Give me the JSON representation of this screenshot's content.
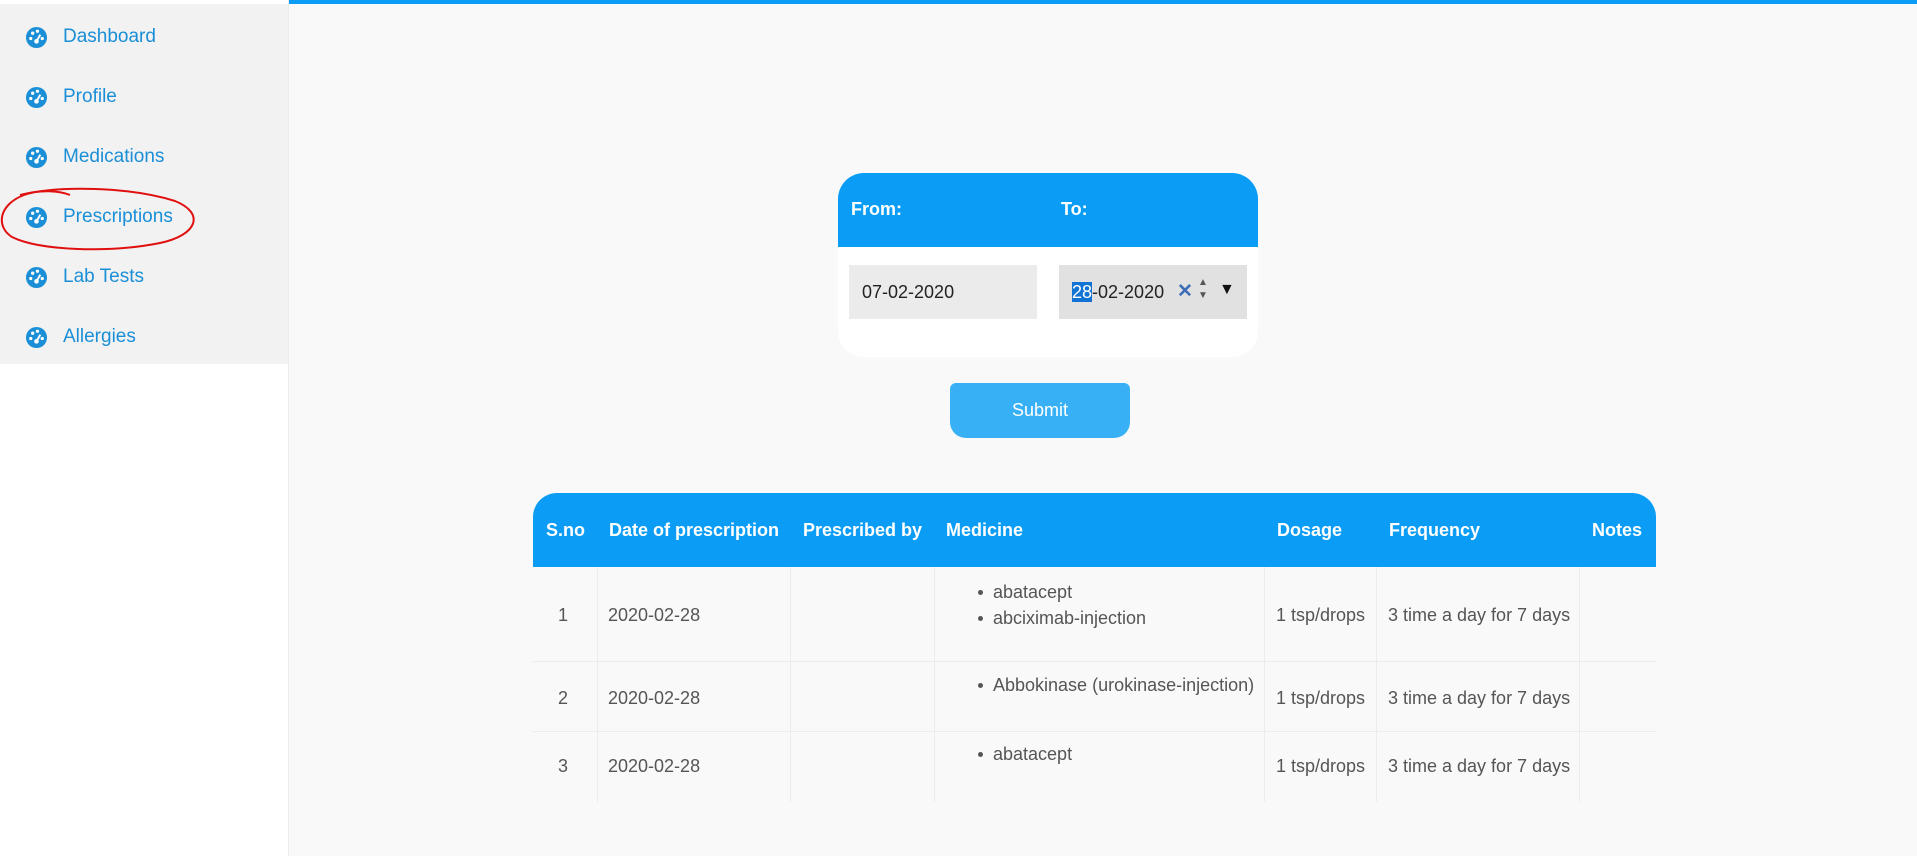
{
  "sidebar": {
    "items": [
      {
        "label": "Dashboard",
        "icon": "dashboard-gauge-icon"
      },
      {
        "label": "Profile",
        "icon": "dashboard-gauge-icon"
      },
      {
        "label": "Medications",
        "icon": "dashboard-gauge-icon"
      },
      {
        "label": "Prescriptions",
        "icon": "dashboard-gauge-icon",
        "highlighted": true
      },
      {
        "label": "Lab Tests",
        "icon": "dashboard-gauge-icon"
      },
      {
        "label": "Allergies",
        "icon": "dashboard-gauge-icon"
      }
    ]
  },
  "filter": {
    "from_label": "From:",
    "to_label": "To:",
    "from_value": "07-02-2020",
    "to_value_selected": "28",
    "to_value_rest": "-02-2020"
  },
  "submit_label": "Submit",
  "table": {
    "headers": [
      "S.no",
      "Date of prescription",
      "Prescribed by",
      "Medicine",
      "Dosage",
      "Frequency",
      "Notes"
    ],
    "rows": [
      {
        "sno": "1",
        "date": "2020-02-28",
        "prescribed_by": "",
        "medicine": [
          "abatacept",
          "abciximab-injection"
        ],
        "dosage": "1 tsp/drops",
        "frequency": "3 time a day for 7 days",
        "notes": ""
      },
      {
        "sno": "2",
        "date": "2020-02-28",
        "prescribed_by": "",
        "medicine": [
          "Abbokinase (urokinase-injection)"
        ],
        "dosage": "1 tsp/drops",
        "frequency": "3 time a day for 7 days",
        "notes": ""
      },
      {
        "sno": "3",
        "date": "2020-02-28",
        "prescribed_by": "",
        "medicine": [
          "abatacept"
        ],
        "dosage": "1 tsp/drops",
        "frequency": "3 time a day for 7 days",
        "notes": ""
      }
    ]
  },
  "colors": {
    "accent": "#0b9cf5",
    "link": "#1a8fd8",
    "annotation": "#e01010"
  }
}
